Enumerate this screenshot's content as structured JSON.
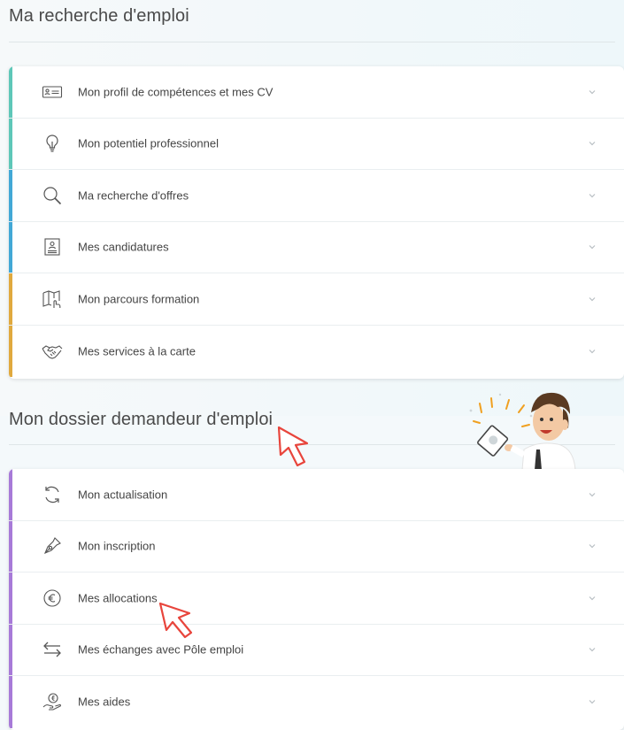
{
  "sections": {
    "search": {
      "title": "Ma recherche d'emploi",
      "items": [
        {
          "label": "Mon profil de compétences et mes CV",
          "icon": "id-card-icon",
          "color": "#5ec7b8"
        },
        {
          "label": "Mon potentiel professionnel",
          "icon": "lightbulb-icon",
          "color": "#5ec7b8"
        },
        {
          "label": "Ma recherche d'offres",
          "icon": "search-icon",
          "color": "#42a8d6"
        },
        {
          "label": "Mes candidatures",
          "icon": "badge-icon",
          "color": "#42a8d6"
        },
        {
          "label": "Mon parcours formation",
          "icon": "map-touch-icon",
          "color": "#e0a93e"
        },
        {
          "label": "Mes services à la carte",
          "icon": "handshake-icon",
          "color": "#e0a93e"
        }
      ]
    },
    "dossier": {
      "title": "Mon dossier demandeur d'emploi",
      "items": [
        {
          "label": "Mon actualisation",
          "icon": "refresh-icon",
          "color": "#a77ad8"
        },
        {
          "label": "Mon inscription",
          "icon": "pen-nib-icon",
          "color": "#a77ad8"
        },
        {
          "label": "Mes allocations",
          "icon": "euro-icon",
          "color": "#a77ad8"
        },
        {
          "label": "Mes échanges avec Pôle emploi",
          "icon": "exchange-arrows-icon",
          "color": "#a77ad8"
        },
        {
          "label": "Mes aides",
          "icon": "hand-coin-icon",
          "color": "#a77ad8"
        }
      ]
    }
  },
  "colors": {
    "pointer": "#e8453c",
    "chevron": "#b8bfc3",
    "icon_stroke": "#555555"
  }
}
